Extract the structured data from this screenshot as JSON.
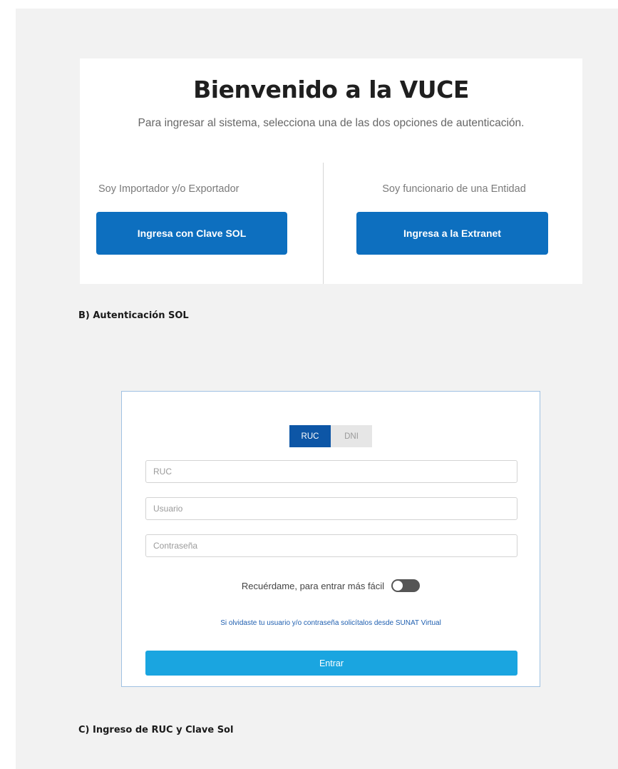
{
  "welcome": {
    "title": "Bienvenido a la VUCE",
    "subtitle": "Para ingresar al sistema, selecciona una de las dos opciones de autenticación.",
    "left_option": {
      "label": "Soy Importador y/o Exportador",
      "button": "Ingresa con Clave SOL"
    },
    "right_option": {
      "label": "Soy funcionario de una Entidad",
      "button": "Ingresa a la Extranet"
    }
  },
  "captions": {
    "b": "B) Autenticación SOL",
    "c": "C) Ingreso de RUC y Clave Sol"
  },
  "login": {
    "tabs": [
      {
        "label": "RUC",
        "active": true
      },
      {
        "label": "DNI",
        "active": false
      }
    ],
    "fields": {
      "ruc_placeholder": "RUC",
      "usuario_placeholder": "Usuario",
      "password_placeholder": "Contraseña"
    },
    "remember_label": "Recuérdame, para entrar más fácil",
    "remember_on": false,
    "forgot_link": "Si olvidaste tu usuario y/o contraseña solicítalos desde SUNAT Virtual",
    "submit": "Entrar"
  },
  "colors": {
    "primary": "#0d6fbf",
    "tab_active": "#0d56a6",
    "submit": "#1aa5e0",
    "background": "#f2f2f2"
  }
}
